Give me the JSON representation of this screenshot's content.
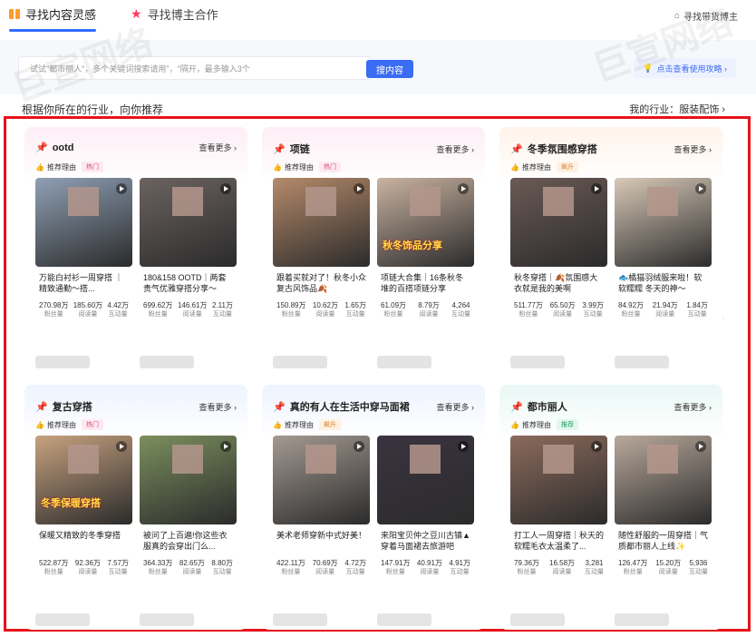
{
  "tabs": [
    {
      "label": "寻找内容灵感",
      "active": true,
      "icon": "book-icon"
    },
    {
      "label": "寻找博主合作",
      "active": false,
      "icon": "star-icon"
    }
  ],
  "top_link": "寻找带货博主",
  "search": {
    "placeholder": "试试\"都市丽人\"，多个关键词搜索请用\"，\"隔开，最多输入3个",
    "button": "搜内容",
    "guide": "点击查看使用攻略 ›"
  },
  "section_title": "根据你所在的行业，向你推荐",
  "industry_text": "我的行业：服装配饰 ›",
  "see_more": "查看更多 ›",
  "reason_label": "推荐理由",
  "stat_labels": {
    "fans": "粉丝量",
    "reads": "阅读量",
    "inter": "互动量"
  },
  "watermark": "巨宣网络",
  "colors": {
    "accent": "#3a6cf4",
    "highlight_frame": "#e6121a"
  },
  "cards": [
    {
      "title": "ootd",
      "tag": "热门",
      "tag_type": "hot",
      "bg": "#fdeef5",
      "posts": [
        {
          "desc": "万能白衬衫一周穿搭 ｜精致通勤～搭...",
          "v1": "270.98万",
          "v2": "185.60万",
          "v3": "4.42万",
          "thumb": "#8fa0b5",
          "overlay": ""
        },
        {
          "desc": "180&158 OOTD｜两套贵气优雅穿搭分享～",
          "v1": "699.62万",
          "v2": "146.61万",
          "v3": "2.11万",
          "thumb": "#6b6360",
          "overlay": ""
        }
      ]
    },
    {
      "title": "项链",
      "tag": "热门",
      "tag_type": "hot",
      "bg": "#fdeef5",
      "posts": [
        {
          "desc": "跟着买就对了！秋冬小众复古风饰品🍂",
          "v1": "150.89万",
          "v2": "10.62万",
          "v3": "1.65万",
          "thumb": "#b58a6a",
          "overlay": ""
        },
        {
          "desc": "项链大合集｜16条秋冬堆的百搭项链分享",
          "v1": "61.09万",
          "v2": "8.79万",
          "v3": "4,264",
          "thumb": "#c9b3a1",
          "overlay": "秋冬饰品分享"
        }
      ]
    },
    {
      "title": "冬季氛围感穿搭",
      "tag": "飙升",
      "tag_type": "up",
      "bg": "#fff3ea",
      "posts": [
        {
          "desc": "秋冬穿搭｜🍂氛围感大衣就是我的美啊",
          "v1": "511.77万",
          "v2": "65.50万",
          "v3": "3.99万",
          "thumb": "#6a5a55",
          "overlay": ""
        },
        {
          "desc": "🐟橘猫羽绒服来啦！软软糯糯 冬天的神～",
          "v1": "84.92万",
          "v2": "21.94万",
          "v3": "1.84万",
          "thumb": "#d8c9b8",
          "overlay": ""
        }
      ]
    },
    {
      "title": "复古穿搭",
      "tag": "热门",
      "tag_type": "hot",
      "bg": "#eef3ff",
      "posts": [
        {
          "desc": "保暖又精致的冬季穿搭",
          "v1": "522.87万",
          "v2": "92.36万",
          "v3": "7.57万",
          "thumb": "#c7a27f",
          "overlay": "冬季保暖穿搭"
        },
        {
          "desc": "被问了上百遍!你这些衣服真的会穿出门么...",
          "v1": "364.33万",
          "v2": "82.65万",
          "v3": "8.80万",
          "thumb": "#7b8f5e",
          "overlay": ""
        }
      ]
    },
    {
      "title": "真的有人在生活中穿马面裙",
      "tag": "飙升",
      "tag_type": "up",
      "bg": "#eef3ff",
      "posts": [
        {
          "desc": "美术老师穿新中式好美！",
          "v1": "422.11万",
          "v2": "70.69万",
          "v3": "4.72万",
          "thumb": "#a49a92",
          "overlay": ""
        },
        {
          "desc": "来阳宝贝仲之豆川古镇▲穿着马面裙去旅游吧",
          "v1": "147.91万",
          "v2": "40.91万",
          "v3": "4.91万",
          "thumb": "#3a3340",
          "overlay": ""
        }
      ]
    },
    {
      "title": "都市丽人",
      "tag": "推荐",
      "tag_type": "rec",
      "bg": "#eaf8f5",
      "posts": [
        {
          "desc": "打工人一周穿搭｜秋天的软糯毛衣太温柔了...",
          "v1": "79.36万",
          "v2": "16.58万",
          "v3": "3,281",
          "thumb": "#8c6b5c",
          "overlay": ""
        },
        {
          "desc": "随性舒服的一周穿搭｜气质都市丽人上线✨",
          "v1": "126.47万",
          "v2": "15.20万",
          "v3": "5,936",
          "thumb": "#b9a99c",
          "overlay": ""
        }
      ]
    }
  ]
}
